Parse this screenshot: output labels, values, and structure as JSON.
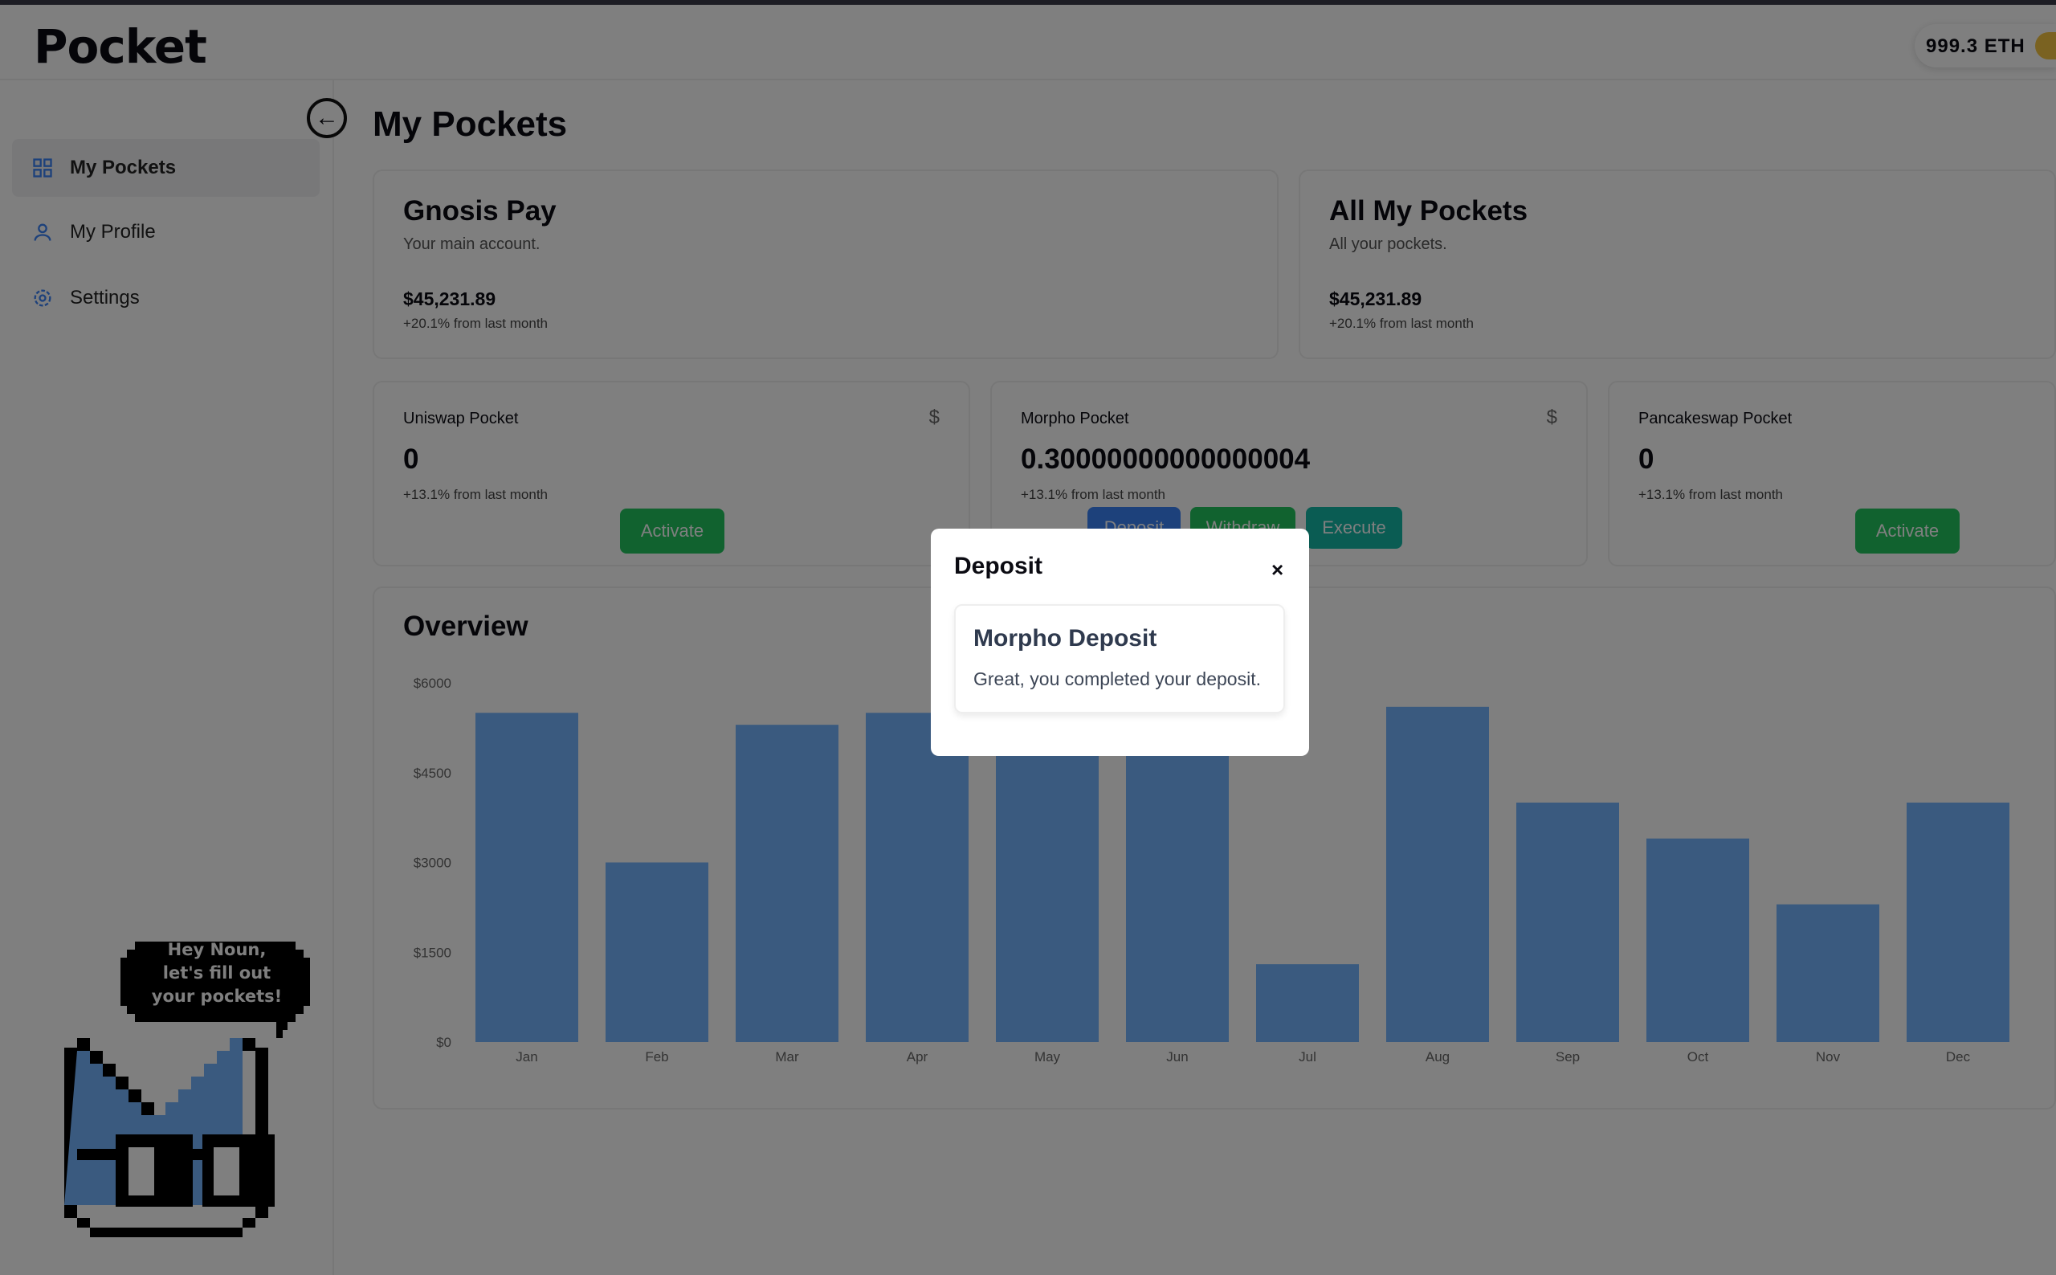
{
  "header": {
    "logo": "Pocket",
    "balance": "999.3 ETH",
    "avatar_icon": "avatar-coin-icon"
  },
  "sidebar": {
    "items": [
      {
        "label": "My Pockets",
        "icon": "grid-icon",
        "active": true
      },
      {
        "label": "My Profile",
        "icon": "user-icon"
      },
      {
        "label": "Settings",
        "icon": "gear-icon"
      }
    ]
  },
  "page": {
    "title": "My Pockets",
    "back_icon": "arrow-left-circle-icon"
  },
  "summary": [
    {
      "title": "Gnosis Pay",
      "subtitle": "Your main account.",
      "amount": "$45,231.89",
      "change": "+20.1% from last month"
    },
    {
      "title": "All My Pockets",
      "subtitle": "All your pockets.",
      "amount": "$45,231.89",
      "change": "+20.1% from last month"
    }
  ],
  "pockets": [
    {
      "name": "Uniswap Pocket",
      "value": "0",
      "change": "+13.1% from last month",
      "icon": "$",
      "action": "Activate"
    },
    {
      "name": "Morpho Pocket",
      "value": "0.30000000000000004",
      "change": "+13.1% from last month",
      "icon": "$",
      "deposit": "Deposit",
      "withdraw": "Withdraw",
      "execute": "Execute"
    },
    {
      "name": "Pancakeswap Pocket",
      "value": "0",
      "change": "+13.1% from last month",
      "action": "Activate"
    }
  ],
  "overview": {
    "title": "Overview"
  },
  "chart_data": {
    "type": "bar",
    "categories": [
      "Jan",
      "Feb",
      "Mar",
      "Apr",
      "May",
      "Jun",
      "Jul",
      "Aug",
      "Sep",
      "Oct",
      "Nov",
      "Dec"
    ],
    "values": [
      5500,
      3000,
      5300,
      5500,
      5000,
      5000,
      1300,
      5600,
      4000,
      3400,
      2300,
      4000
    ],
    "yticks": [
      "$0",
      "$1500",
      "$3000",
      "$4500",
      "$6000"
    ],
    "ylim": [
      0,
      6000
    ],
    "grid": false,
    "color": "#74b4fe"
  },
  "modal": {
    "title": "Deposit",
    "close": "×",
    "card_title": "Morpho Deposit",
    "card_body": "Great, you completed your deposit."
  },
  "mascot": {
    "speech": [
      "Hey Noun,",
      "let's fill out",
      "your pockets!"
    ]
  }
}
